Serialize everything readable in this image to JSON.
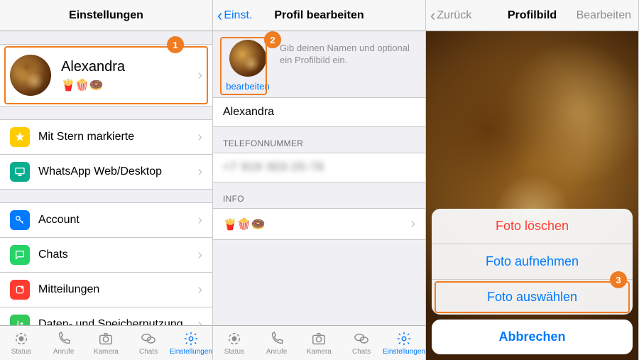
{
  "screen1": {
    "title": "Einstellungen",
    "profile": {
      "name": "Alexandra",
      "status_emoji": "🍟🍿🍩"
    },
    "rows": {
      "starred": "Mit Stern markierte",
      "web": "WhatsApp Web/Desktop",
      "account": "Account",
      "chats": "Chats",
      "notifications": "Mitteilungen",
      "storage": "Daten- und Speichernutzung"
    },
    "tabs": {
      "status": "Status",
      "calls": "Anrufe",
      "camera": "Kamera",
      "chats": "Chats",
      "settings": "Einstellungen"
    },
    "callout": "1"
  },
  "screen2": {
    "back": "Einst.",
    "title": "Profil bearbeiten",
    "hint": "Gib deinen Namen und optional ein Profilbild ein.",
    "edit_link": "bearbeiten",
    "name_value": "Alexandra",
    "phone_header": "TELEFONNUMMER",
    "phone_value_masked": "+7 919 303-25-76",
    "info_header": "INFO",
    "info_emoji": "🍟🍿🍩",
    "tabs": {
      "status": "Status",
      "calls": "Anrufe",
      "camera": "Kamera",
      "chats": "Chats",
      "settings": "Einstellungen"
    },
    "callout": "2"
  },
  "screen3": {
    "back": "Zurück",
    "title": "Profilbild",
    "right": "Bearbeiten",
    "sheet": {
      "delete": "Foto löschen",
      "take": "Foto aufnehmen",
      "choose": "Foto auswählen"
    },
    "cancel": "Abbrechen",
    "callout": "3"
  }
}
